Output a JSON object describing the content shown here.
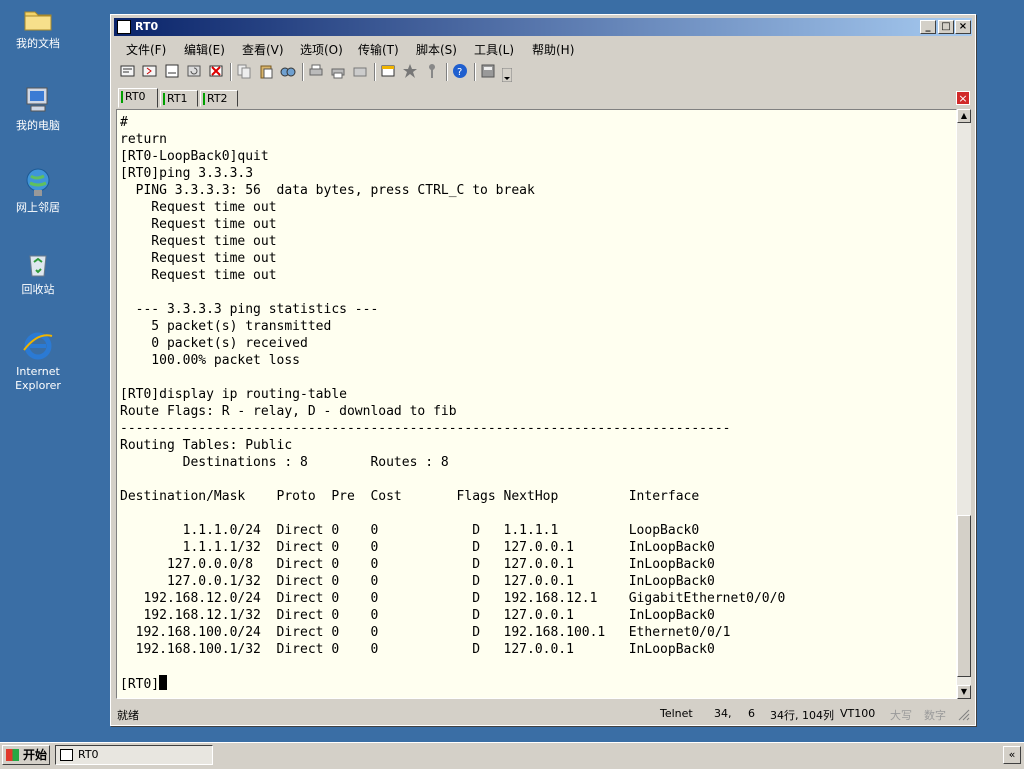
{
  "desktop": {
    "icons": [
      {
        "label": "我的文档"
      },
      {
        "label": "我的电脑"
      },
      {
        "label": "网上邻居"
      },
      {
        "label": "回收站"
      },
      {
        "label": "Internet Explorer"
      }
    ]
  },
  "window": {
    "title": "RT0",
    "controls": {
      "minimize": "_",
      "maximize": "□",
      "close": "×"
    }
  },
  "menu": {
    "items": [
      {
        "label": "文件(F)"
      },
      {
        "label": "编辑(E)"
      },
      {
        "label": "查看(V)"
      },
      {
        "label": "选项(O)"
      },
      {
        "label": "传输(T)"
      },
      {
        "label": "脚本(S)"
      },
      {
        "label": "工具(L)"
      },
      {
        "label": "帮助(H)"
      }
    ]
  },
  "tabs": [
    {
      "label": "RT0",
      "active": true
    },
    {
      "label": "RT1",
      "active": false
    },
    {
      "label": "RT2",
      "active": false
    }
  ],
  "terminal": {
    "text": "#\nreturn\n[RT0-LoopBack0]quit\n[RT0]ping 3.3.3.3\n  PING 3.3.3.3: 56  data bytes, press CTRL_C to break\n    Request time out\n    Request time out\n    Request time out\n    Request time out\n    Request time out\n\n  --- 3.3.3.3 ping statistics ---\n    5 packet(s) transmitted\n    0 packet(s) received\n    100.00% packet loss\n\n[RT0]display ip routing-table\nRoute Flags: R - relay, D - download to fib\n------------------------------------------------------------------------------\nRouting Tables: Public\n        Destinations : 8        Routes : 8\n\nDestination/Mask    Proto  Pre  Cost       Flags NextHop         Interface\n\n        1.1.1.0/24  Direct 0    0            D   1.1.1.1         LoopBack0\n        1.1.1.1/32  Direct 0    0            D   127.0.0.1       InLoopBack0\n      127.0.0.0/8   Direct 0    0            D   127.0.0.1       InLoopBack0\n      127.0.0.1/32  Direct 0    0            D   127.0.0.1       InLoopBack0\n   192.168.12.0/24  Direct 0    0            D   192.168.12.1    GigabitEthernet0/0/0\n   192.168.12.1/32  Direct 0    0            D   127.0.0.1       InLoopBack0\n  192.168.100.0/24  Direct 0    0            D   192.168.100.1   Ethernet0/0/1\n  192.168.100.1/32  Direct 0    0            D   127.0.0.1       InLoopBack0\n\n",
    "prompt": "[RT0]"
  },
  "status": {
    "ready": "就绪",
    "protocol": "Telnet",
    "row": "34,",
    "col": "6",
    "size": "34行, 104列",
    "emulation": "VT100",
    "caps": "大写",
    "num": "数字"
  },
  "taskbar": {
    "start": "开始",
    "window_item": "RT0",
    "tray_toggle": "«"
  }
}
